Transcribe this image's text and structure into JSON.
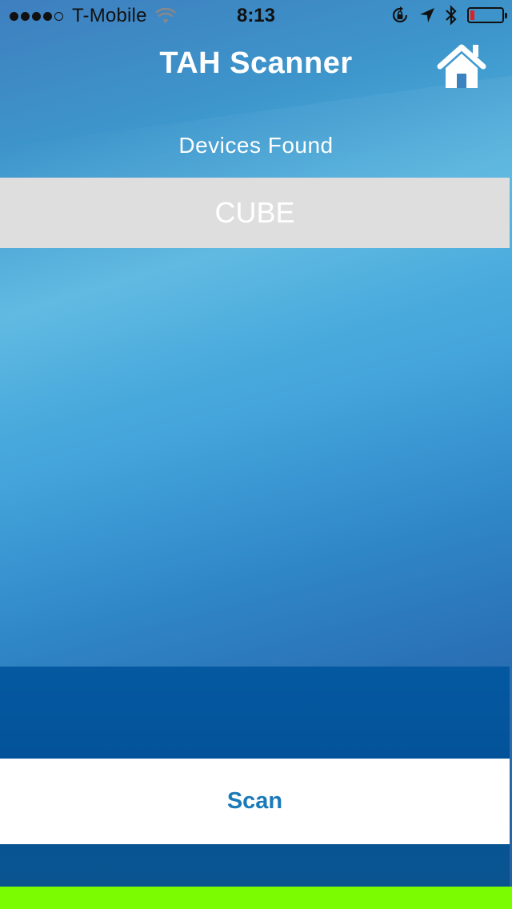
{
  "status_bar": {
    "signal_bars": 4,
    "signal_total": 5,
    "carrier": "T-Mobile",
    "time": "8:13",
    "icons": [
      "wifi-icon",
      "rotation-lock-icon",
      "location-arrow-icon",
      "bluetooth-icon",
      "battery-icon"
    ],
    "battery_level": 0.12,
    "battery_color": "#e02020"
  },
  "nav": {
    "title": "TAH Scanner",
    "home_icon": "home-icon"
  },
  "subtitle": "Devices Found",
  "devices": [
    {
      "name": "CUBE"
    }
  ],
  "scan_button": {
    "label": "Scan"
  },
  "colors": {
    "accent": "#1a7ab8",
    "device_row_bg": "#dedede",
    "panel_bg": "#04569c",
    "bottom_bar": "#7cfc00"
  }
}
